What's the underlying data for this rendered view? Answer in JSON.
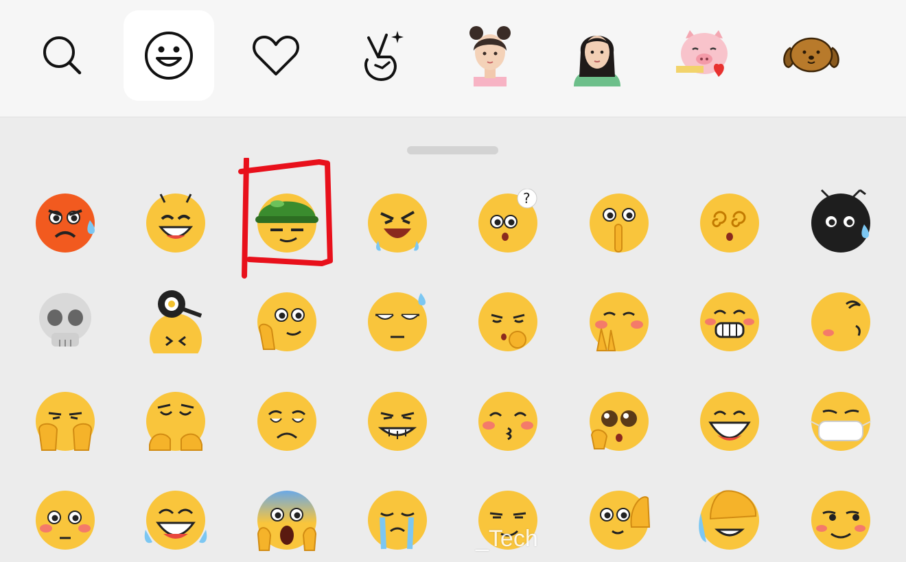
{
  "toolbar": {
    "tabs": [
      {
        "name": "search",
        "icon": "search-icon",
        "active": false
      },
      {
        "name": "emoji",
        "icon": "smiley-face-icon",
        "active": true
      },
      {
        "name": "favorites",
        "icon": "heart-icon",
        "active": false
      },
      {
        "name": "stickers",
        "icon": "victory-hand-icon",
        "active": false
      },
      {
        "name": "sticker-pack-girl-buns",
        "icon": "avatar-girl-buns-icon",
        "active": false
      },
      {
        "name": "sticker-pack-girl-longhair",
        "icon": "avatar-girl-longhair-icon",
        "active": false
      },
      {
        "name": "sticker-pack-pig",
        "icon": "pig-heart-icon",
        "active": false
      },
      {
        "name": "sticker-pack-dog",
        "icon": "dog-icon",
        "active": false
      }
    ]
  },
  "emoji_grid": {
    "rows": [
      [
        "angry-sweat",
        "smile-antenna",
        "soldier-helmet",
        "crying-rage",
        "confused-question",
        "shush",
        "dizzy",
        "black-face-sweat"
      ],
      [
        "skull",
        "frying-pan-head",
        "facepalm-peek",
        "eyeroll-sweat",
        "thinking-smirk",
        "blushing-hands",
        "grin-blush",
        "silly-tongue"
      ],
      [
        "smirk-hands",
        "shy-fingers",
        "sad-frown",
        "squint-grin",
        "kissing",
        "pleading",
        "big-smile",
        "mask"
      ],
      [
        "flushed",
        "tears-of-joy",
        "screaming",
        "sobbing",
        "smirk",
        "face-with-hand",
        "hand-over-eyes",
        "side-eye-smile"
      ]
    ],
    "highlighted": "soldier-helmet"
  },
  "colors": {
    "emoji_yellow": "#f9c53c",
    "highlight_red": "#e8101b",
    "toolbar_bg": "#f6f6f6",
    "panel_bg": "#ececec"
  },
  "watermark": {
    "text": "_Tech"
  }
}
